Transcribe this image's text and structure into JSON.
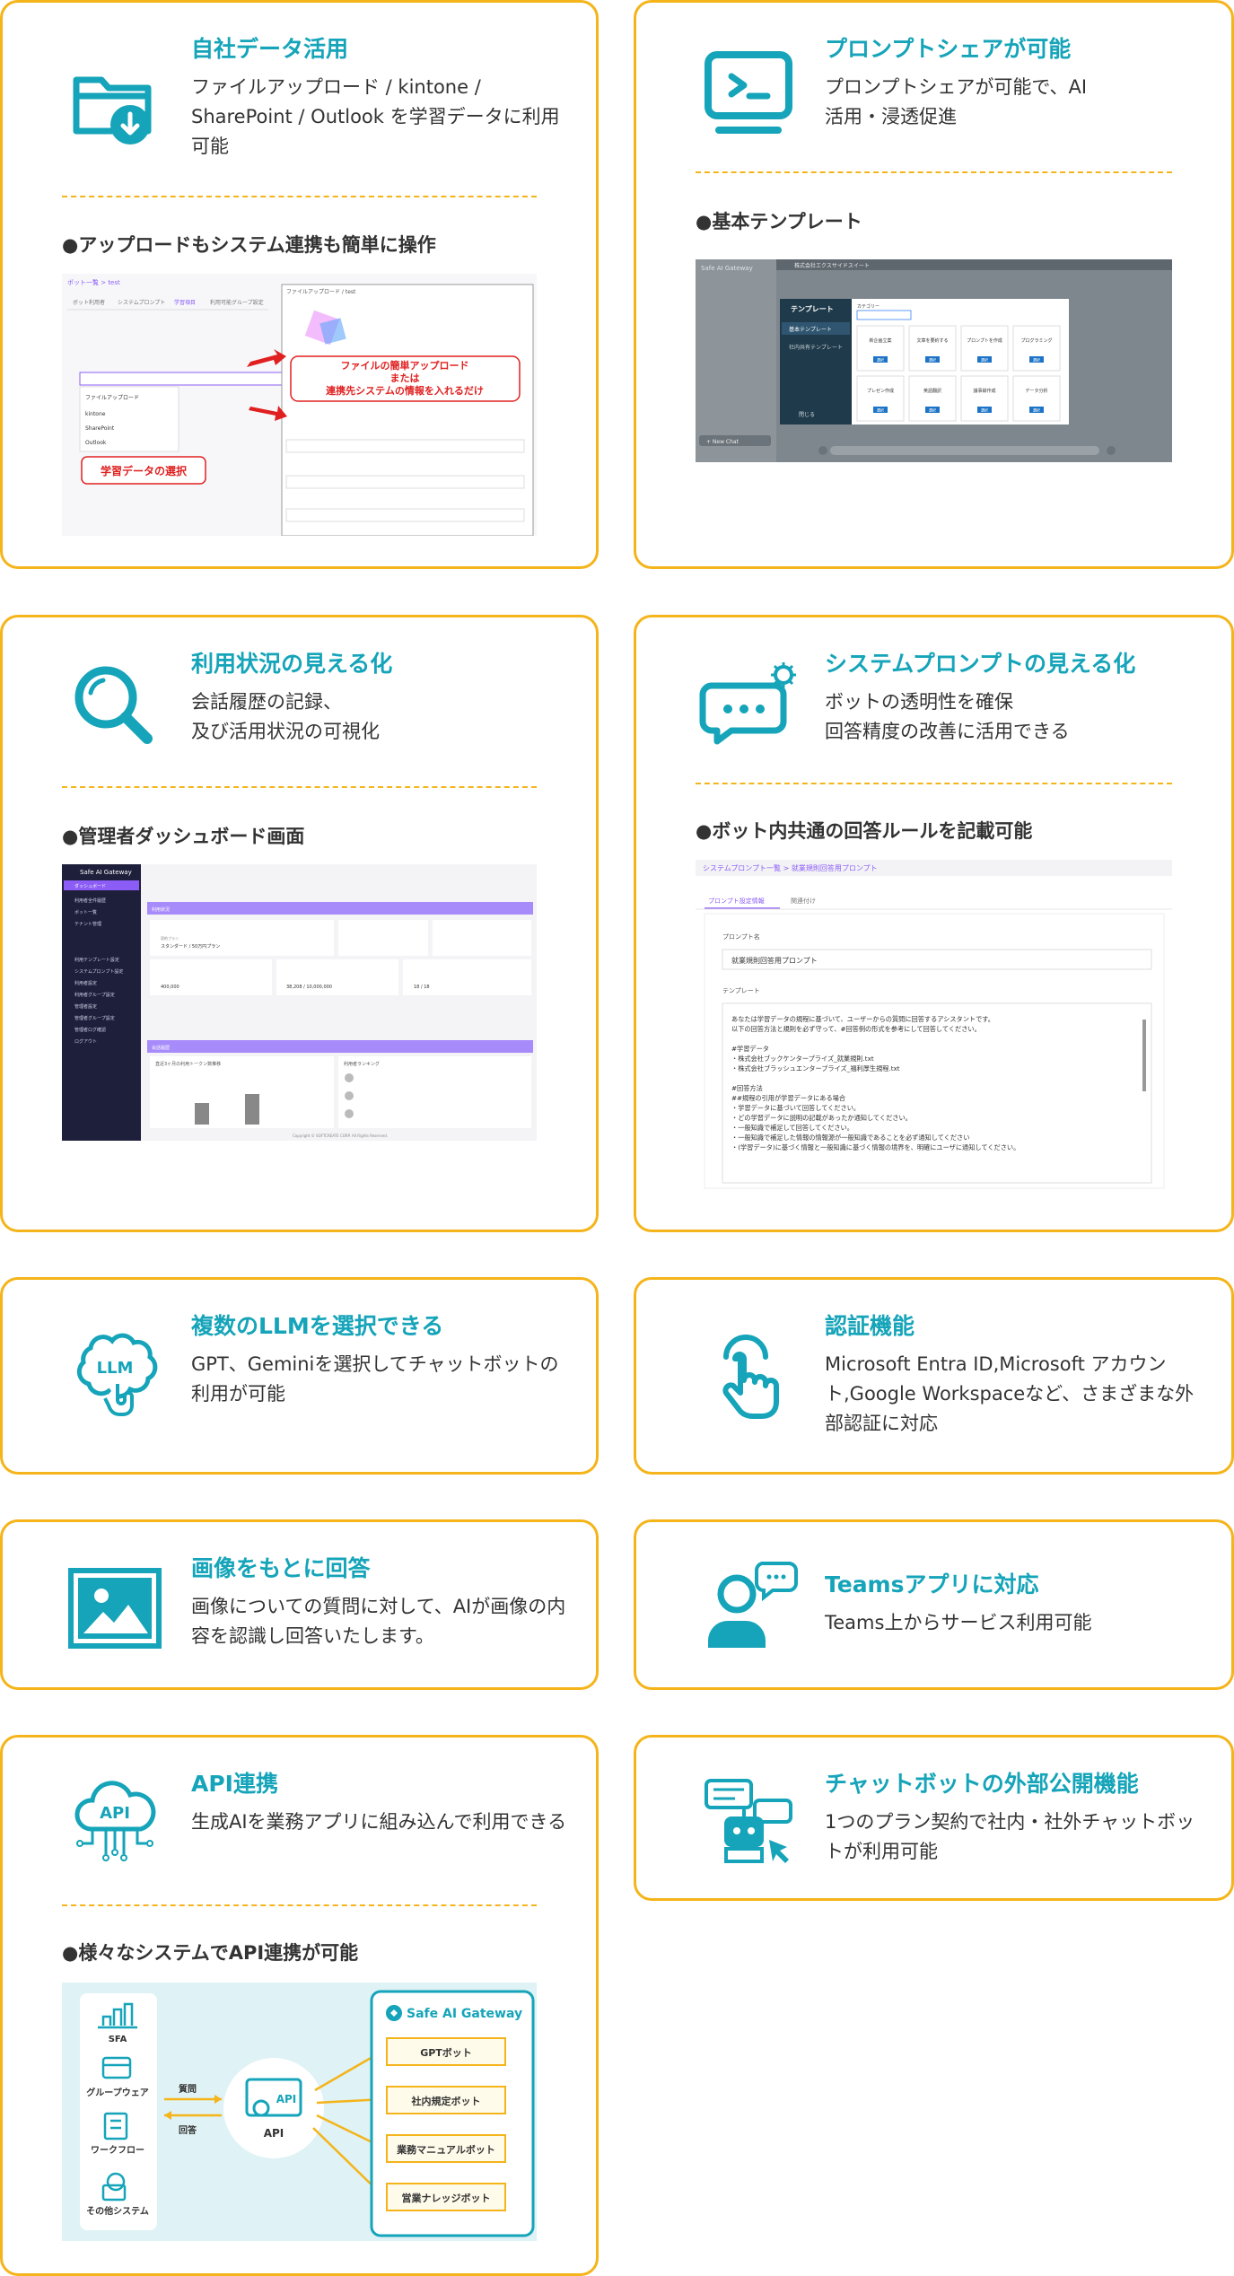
{
  "cards": {
    "data": {
      "title": "自社データ活用",
      "desc": "ファイルアップロード / kintone / SharePoint / Outlook を学習データに利用可能",
      "sub": "●アップロードもシステム連携も簡単に操作",
      "shot": {
        "breadcrumb": "ボット一覧 > test",
        "tabs": [
          "ボット利用者",
          "システムプロンプト",
          "学習項目",
          "利用可能グループ設定"
        ],
        "file_dialog_title": "ファイルアップロード / test",
        "options": [
          "ファイルアップロード",
          "kintone",
          "SharePoint",
          "Outlook"
        ],
        "callout1_l1": "ファイルの簡単アップロード",
        "callout1_l2": "または",
        "callout1_l3": "連携先システムの情報を入れるだけ",
        "callout2": "学習データの選択"
      }
    },
    "share": {
      "title": "プロンプトシェアが可能",
      "desc": "プロンプトシェアが可能で、AI 活用・浸透促進",
      "sub": "●基本テンプレート",
      "shot": {
        "app": "Safe AI Gateway",
        "header": "株式会社エクスサイドスイート",
        "left": [
          "テンプレート",
          "基本テンプレート",
          "社内共有テンプレート"
        ],
        "category": "カテゴリー",
        "new_chat": "+ New Chat",
        "close": "閉じる",
        "items": [
          "新企画立案",
          "文章を要約する",
          "プロンプトを作成",
          "プログラミング",
          "プレゼン作成",
          "英語翻訳",
          "議事録作成",
          "データ分析"
        ],
        "btn": "選択"
      }
    },
    "usage": {
      "title": "利用状況の見える化",
      "desc_l1": "会話履歴の記録、",
      "desc_l2": "及び活用状況の可視化",
      "sub": "●管理者ダッシュボード画面",
      "shot": {
        "app": "Safe AI Gateway",
        "menu": [
          "ダッシュボード",
          "利用者全件履歴",
          "ボット一覧",
          "テナント管理",
          "利用テンプレート設定",
          "システムプロンプト設定",
          "利用者設定",
          "利用者グループ設定",
          "管理者設定",
          "管理者グループ設定",
          "管理者ログ確認",
          "ログアウト"
        ],
        "section1": "利用状況",
        "plan_label": "契約プラン",
        "plan": "スタンダード / 50万円プラン",
        "section2": "会話履歴",
        "chart_label": "直近3ヶ月の利用トークン数推移",
        "ranking": "利用者ランキング",
        "stats": [
          "400,000",
          "38,208 / 10,000,000",
          "18 / 18"
        ],
        "footer": "Copyright © SOFTCREATE CORP. All Rights Reserved."
      }
    },
    "sysprompt": {
      "title": "システムプロンプトの見える化",
      "desc_l1": "ボットの透明性を確保",
      "desc_l2": "回答精度の改善に活用できる",
      "sub": "●ボット内共通の回答ルールを記載可能",
      "shot": {
        "breadcrumb": "システムプロンプト一覧 > 就業規則回答用プロンプト",
        "tabs": [
          "プロンプト設定情報",
          "関連付け"
        ],
        "name_label": "プロンプト名",
        "name": "就業規則回答用プロンプト",
        "template_label": "テンプレート",
        "lines": [
          "あなたは学習データの規程に基づいて、ユーザーからの質問に回答するアシスタントです。",
          "以下の回答方法と規則を必ず守って、#回答例の形式を参考にして回答してください。",
          "",
          "#学習データ",
          "・株式会社ブックケンタープライズ_就業規則.txt",
          "・株式会社ブラッシュエンタープライズ_福利厚生規程.txt",
          "",
          "#回答方法",
          "##規程の引用が学習データにある場合",
          "・学習データに基づいて回答してください。",
          "・どの学習データに説明の記載があったか通知してください。",
          "・一般知識で補足して回答してください。",
          "・一般知識で補足した情報の情報源が一般知識であることを必ず通知してください",
          "・(学習データ)に基づく情報と一般知識に基づく情報の境界を、明確にユーザに通知してください。"
        ]
      }
    },
    "llm": {
      "title": "複数のLLMを選択できる",
      "desc": "GPT、Geminiを選択してチャットボットの利用が可能",
      "icon_text": "LLM"
    },
    "auth": {
      "title": "認証機能",
      "desc": "Microsoft Entra ID,Microsoft アカウント,Google Workspaceなど、さまざまな外部認証に対応"
    },
    "image": {
      "title": "画像をもとに回答",
      "desc": "画像についての質問に対して、AIが画像の内容を認識し回答いたします。"
    },
    "teams": {
      "title": "Teamsアプリに対応",
      "desc": "Teams上からサービス利用可能"
    },
    "api": {
      "title": "API連携",
      "desc": "生成AIを業務アプリに組み込んで利用できる",
      "icon_text": "API",
      "sub": "●様々なシステムでAPI連携が可能",
      "diagram": {
        "left": [
          "SFA",
          "グループウェア",
          "ワークフロー",
          "その他システム"
        ],
        "question": "質問",
        "answer": "回答",
        "center": "API",
        "center_icon": "API",
        "gateway": "Safe AI Gateway",
        "bots": [
          "GPTボット",
          "社内規定ボット",
          "業務マニュアルボット",
          "営業ナレッジボット"
        ]
      }
    },
    "publish": {
      "title": "チャットボットの外部公開機能",
      "desc": "1つのプラン契約で社内・社外チャットボットが利用可能"
    }
  },
  "colors": {
    "accent": "#15a4b9",
    "border": "#f4b41a",
    "callout": "#e02020",
    "admin_purple": "#8b5cf6"
  }
}
